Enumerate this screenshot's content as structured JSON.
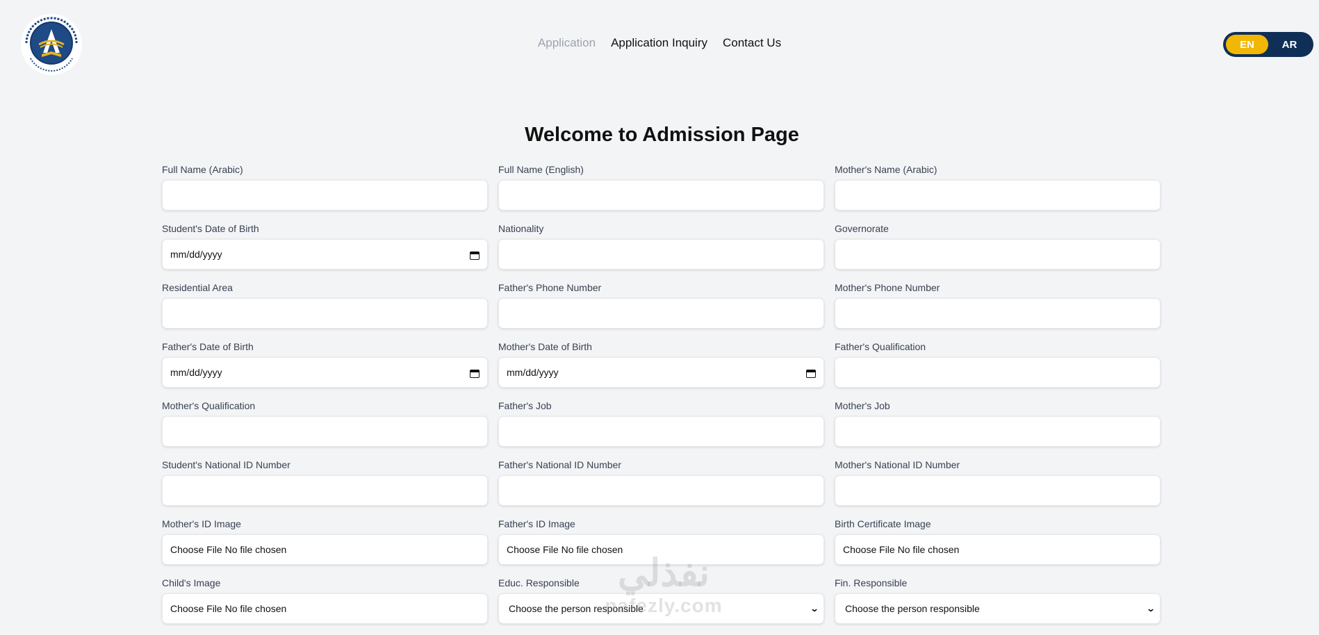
{
  "header": {
    "nav": [
      "Application",
      "Application Inquiry",
      "Contact Us"
    ],
    "lang": {
      "en": "EN",
      "ar": "AR"
    }
  },
  "page_title": "Welcome to Admission Page",
  "fields": [
    {
      "label": "Full Name (Arabic)",
      "type": "text",
      "value": ""
    },
    {
      "label": "Full Name (English)",
      "type": "text",
      "value": ""
    },
    {
      "label": "Mother's Name (Arabic)",
      "type": "text",
      "value": ""
    },
    {
      "label": "Student's Date of Birth",
      "type": "date",
      "value": "mm/dd/yyyy"
    },
    {
      "label": "Nationality",
      "type": "text",
      "value": ""
    },
    {
      "label": "Governorate",
      "type": "text",
      "value": ""
    },
    {
      "label": "Residential Area",
      "type": "text",
      "value": ""
    },
    {
      "label": "Father's Phone Number",
      "type": "text",
      "value": ""
    },
    {
      "label": "Mother's Phone Number",
      "type": "text",
      "value": ""
    },
    {
      "label": "Father's Date of Birth",
      "type": "date",
      "value": "mm/dd/yyyy"
    },
    {
      "label": "Mother's Date of Birth",
      "type": "date",
      "value": "mm/dd/yyyy"
    },
    {
      "label": "Father's Qualification",
      "type": "text",
      "value": ""
    },
    {
      "label": "Mother's Qualification",
      "type": "text",
      "value": ""
    },
    {
      "label": "Father's Job",
      "type": "text",
      "value": ""
    },
    {
      "label": "Mother's Job",
      "type": "text",
      "value": ""
    },
    {
      "label": "Student's National ID Number",
      "type": "text",
      "value": ""
    },
    {
      "label": "Father's National ID Number",
      "type": "text",
      "value": ""
    },
    {
      "label": "Mother's National ID Number",
      "type": "text",
      "value": ""
    },
    {
      "label": "Mother's ID Image",
      "type": "file",
      "value": "Choose File No file chosen"
    },
    {
      "label": "Father's ID Image",
      "type": "file",
      "value": "Choose File No file chosen"
    },
    {
      "label": "Birth Certificate Image",
      "type": "file",
      "value": "Choose File No file chosen"
    },
    {
      "label": "Child's Image",
      "type": "file",
      "value": "Choose File No file chosen"
    },
    {
      "label": "Educ. Responsible",
      "type": "select",
      "value": "Choose the person responsible"
    },
    {
      "label": "Fin. Responsible",
      "type": "select",
      "value": "Choose the person responsible"
    }
  ],
  "watermark": {
    "arabic": "نفذلي",
    "latin": "nafezly.com"
  },
  "colors": {
    "background": "#f3f4f6",
    "lang_toggle": "#0f2f57",
    "lang_active": "#f2b705"
  },
  "icons": [
    "school-logo-icon",
    "calendar-icon",
    "chevron-down-icon"
  ]
}
